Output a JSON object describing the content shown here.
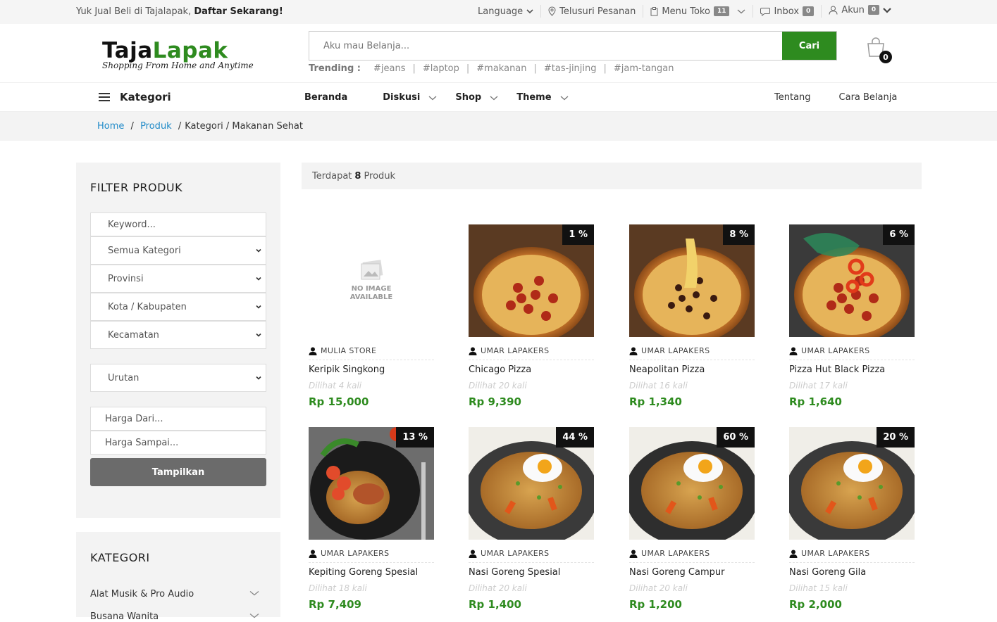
{
  "topbar": {
    "promo_text": "Yuk Jual Beli di Tajalapak,",
    "promo_link": "Daftar Sekarang!",
    "language": "Language",
    "track_orders": "Telusuri Pesanan",
    "store_menu": "Menu Toko",
    "store_count": "11",
    "inbox": "Inbox",
    "inbox_count": "0",
    "account": "Akun",
    "account_count": "0"
  },
  "header": {
    "logo_part1": "Taja",
    "logo_part2": "Lapak",
    "tagline": "Shopping From Home and Anytime",
    "search_placeholder": "Aku mau Belanja...",
    "search_button": "Cari",
    "trending_label": "Trending :",
    "trending": [
      "#jeans",
      "#laptop",
      "#makanan",
      "#tas-jinjing",
      "#jam-tangan"
    ],
    "cart_count": "0"
  },
  "nav": {
    "category": "Kategori",
    "home": "Beranda",
    "discussion": "Diskusi",
    "shop": "Shop",
    "theme": "Theme",
    "about": "Tentang",
    "how_to_shop": "Cara Belanja"
  },
  "breadcrumb": {
    "home": "Home",
    "product": "Produk",
    "rest": "Kategori / Makanan Sehat"
  },
  "filter": {
    "title": "FILTER PRODUK",
    "keyword_placeholder": "Keyword...",
    "all_categories": "Semua Kategori",
    "province": "Provinsi",
    "city": "Kota / Kabupaten",
    "district": "Kecamatan",
    "sort": "Urutan",
    "price_from": "Harga Dari...",
    "price_to": "Harga Sampai...",
    "show_button": "Tampilkan"
  },
  "categories": {
    "title": "KATEGORI",
    "items": [
      "Alat Musik & Pro Audio",
      "Busana Wanita"
    ]
  },
  "results": {
    "prefix": "Terdapat",
    "count": "8",
    "suffix": "Produk"
  },
  "no_image": {
    "line1": "NO IMAGE",
    "line2": "AVAILABLE"
  },
  "products": [
    {
      "store": "MULIA STORE",
      "name": "Keripik Singkong",
      "views": "Dilihat 4 kali",
      "price": "Rp 15,000",
      "discount": "",
      "image": "no-image"
    },
    {
      "store": "UMAR LAPAKERS",
      "name": "Chicago Pizza",
      "views": "Dilihat 20 kali",
      "price": "Rp 9,390",
      "discount": "1 %",
      "image": "pizza-pepperoni"
    },
    {
      "store": "UMAR LAPAKERS",
      "name": "Neapolitan Pizza",
      "views": "Dilihat 16 kali",
      "price": "Rp 1,340",
      "discount": "8 %",
      "image": "pizza-cheese"
    },
    {
      "store": "UMAR LAPAKERS",
      "name": "Pizza Hut Black Pizza",
      "views": "Dilihat 17 kali",
      "price": "Rp 1,640",
      "discount": "6 %",
      "image": "pizza-pepper"
    },
    {
      "store": "UMAR LAPAKERS",
      "name": "Kepiting Goreng Spesial",
      "views": "Dilihat 18 kali",
      "price": "Rp 7,409",
      "discount": "13 %",
      "image": "crab-rice"
    },
    {
      "store": "UMAR LAPAKERS",
      "name": "Nasi Goreng Spesial",
      "views": "Dilihat 20 kali",
      "price": "Rp 1,400",
      "discount": "44 %",
      "image": "fried-rice"
    },
    {
      "store": "UMAR LAPAKERS",
      "name": "Nasi Goreng Campur",
      "views": "Dilihat 20 kali",
      "price": "Rp 1,200",
      "discount": "60 %",
      "image": "fried-rice-2"
    },
    {
      "store": "UMAR LAPAKERS",
      "name": "Nasi Goreng Gila",
      "views": "Dilihat 15 kali",
      "price": "Rp 2,000",
      "discount": "20 %",
      "image": "fried-rice"
    }
  ],
  "colors": {
    "brand_green": "#2e8b1f",
    "link_blue": "#1f8ac8",
    "badge_black": "#111111"
  }
}
